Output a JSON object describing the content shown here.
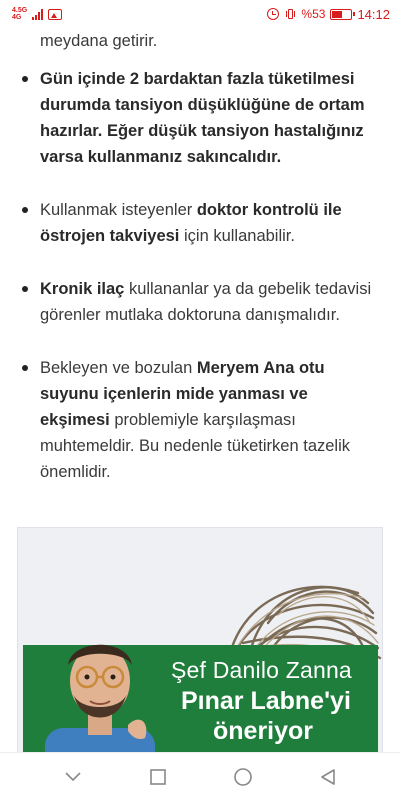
{
  "status_bar": {
    "network_top": "4.5G",
    "network_bottom": "4G",
    "battery_percent": "%53",
    "battery_level": 0.53,
    "time": "14:12",
    "color": "#d81b1b"
  },
  "article": {
    "partial_top": [
      {
        "text": "Kusmayı tetiklediği için vücutta su kaybını da meydana getirir.",
        "bold": false
      }
    ],
    "bullets": [
      [
        {
          "text": "Gün içinde 2 bardaktan fazla tüketilmesi durumda tansiyon düşüklüğüne de ortam hazırlar. Eğer düşük tansiyon hastalığınız varsa kullanmanız sakıncalıdır.",
          "bold": true
        }
      ],
      [
        {
          "text": "Kullanmak isteyenler ",
          "bold": false
        },
        {
          "text": "doktor kontrolü ile östrojen takviyesi",
          "bold": true
        },
        {
          "text": " için kullanabilir.",
          "bold": false
        }
      ],
      [
        {
          "text": "Kronik ilaç",
          "bold": true
        },
        {
          "text": " kullananlar ya da gebelik tedavisi görenler mutlaka doktoruna danışmalıdır.",
          "bold": false
        }
      ],
      [
        {
          "text": "Bekleyen ve bozulan ",
          "bold": false
        },
        {
          "text": "Meryem Ana otu suyunu içenlerin mide yanması ve ekşimesi",
          "bold": true
        },
        {
          "text": " problemiyle karşılaşması muhtemeldir. Bu nedenle tüketirken tazelik önemlidir.",
          "bold": false
        }
      ]
    ]
  },
  "ad": {
    "line1": "Şef Danilo Zanna",
    "line2": "Pınar Labne'yi",
    "line3": "öneriyor",
    "banner_color": "#1f7e3b"
  },
  "nav_bar": {
    "icons": [
      "back-chevron-icon",
      "square-icon",
      "circle-home-icon",
      "triangle-back-icon"
    ]
  }
}
